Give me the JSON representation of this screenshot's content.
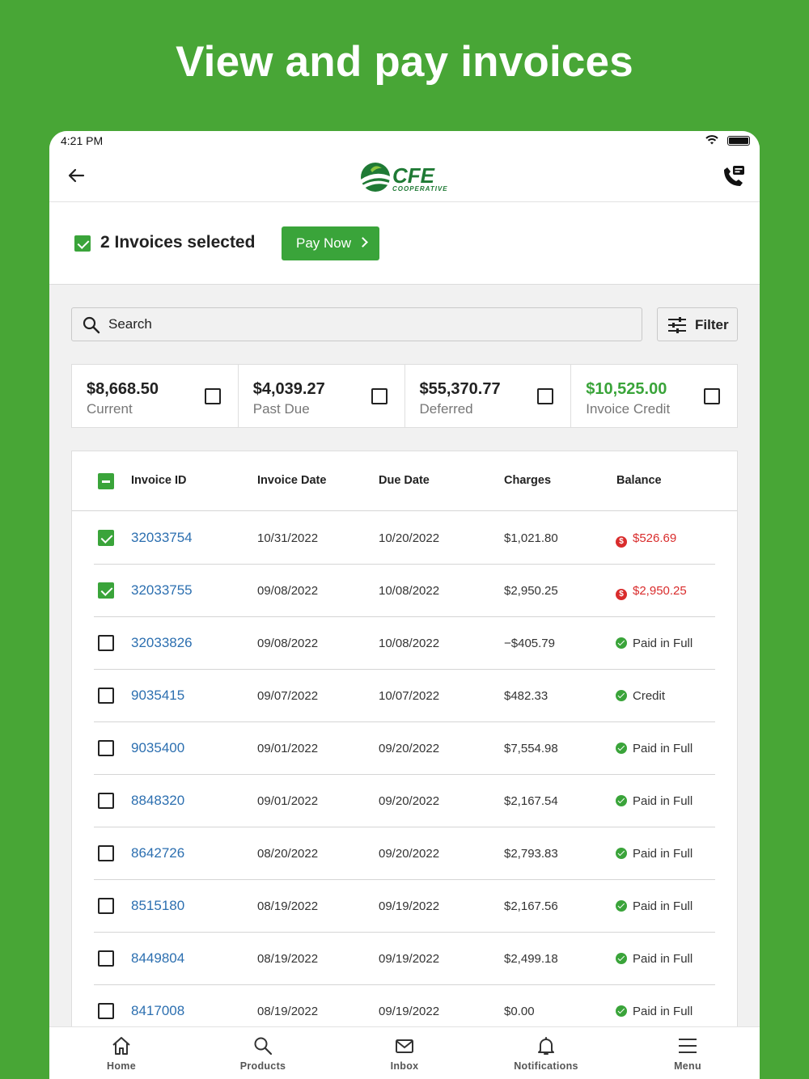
{
  "headline": "View and pay invoices",
  "status_bar": {
    "time": "4:21 PM"
  },
  "app_bar": {
    "logo_text": "CFE",
    "logo_subtext": "COOPERATIVE"
  },
  "selection": {
    "text": "2 Invoices selected",
    "pay_label": "Pay Now"
  },
  "search": {
    "placeholder": "Search"
  },
  "filter_label": "Filter",
  "summary": [
    {
      "amount": "$8,668.50",
      "label": "Current",
      "accent": false,
      "checked": false
    },
    {
      "amount": "$4,039.27",
      "label": "Past Due",
      "accent": false,
      "checked": false
    },
    {
      "amount": "$55,370.77",
      "label": "Deferred",
      "accent": false,
      "checked": false
    },
    {
      "amount": "$10,525.00",
      "label": "Invoice Credit",
      "accent": true,
      "checked": false
    }
  ],
  "table": {
    "headers": {
      "invoice_id": "Invoice ID",
      "invoice_date": "Invoice Date",
      "due_date": "Due Date",
      "charges": "Charges",
      "balance": "Balance"
    },
    "rows": [
      {
        "id": "32033754",
        "invoice_date": "10/31/2022",
        "due_date": "10/20/2022",
        "charges": "$1,021.80",
        "balance": "$526.69",
        "status": "due",
        "checked": true
      },
      {
        "id": "32033755",
        "invoice_date": "09/08/2022",
        "due_date": "10/08/2022",
        "charges": "$2,950.25",
        "balance": "$2,950.25",
        "status": "due",
        "checked": true
      },
      {
        "id": "32033826",
        "invoice_date": "09/08/2022",
        "due_date": "10/08/2022",
        "charges": "−$405.79",
        "balance": "Paid in Full",
        "status": "paid",
        "checked": false
      },
      {
        "id": "9035415",
        "invoice_date": "09/07/2022",
        "due_date": "10/07/2022",
        "charges": "$482.33",
        "balance": "Credit",
        "status": "paid",
        "checked": false
      },
      {
        "id": "9035400",
        "invoice_date": "09/01/2022",
        "due_date": "09/20/2022",
        "charges": "$7,554.98",
        "balance": "Paid in Full",
        "status": "paid",
        "checked": false
      },
      {
        "id": "8848320",
        "invoice_date": "09/01/2022",
        "due_date": "09/20/2022",
        "charges": "$2,167.54",
        "balance": "Paid in Full",
        "status": "paid",
        "checked": false
      },
      {
        "id": "8642726",
        "invoice_date": "08/20/2022",
        "due_date": "09/20/2022",
        "charges": "$2,793.83",
        "balance": "Paid in Full",
        "status": "paid",
        "checked": false
      },
      {
        "id": "8515180",
        "invoice_date": "08/19/2022",
        "due_date": "09/19/2022",
        "charges": "$2,167.56",
        "balance": "Paid in Full",
        "status": "paid",
        "checked": false
      },
      {
        "id": "8449804",
        "invoice_date": "08/19/2022",
        "due_date": "09/19/2022",
        "charges": "$2,499.18",
        "balance": "Paid in Full",
        "status": "paid",
        "checked": false
      },
      {
        "id": "8417008",
        "invoice_date": "08/19/2022",
        "due_date": "09/19/2022",
        "charges": "$0.00",
        "balance": "Paid in Full",
        "status": "paid",
        "checked": false
      }
    ]
  },
  "tabs": [
    {
      "label": "Home",
      "icon": "home-icon"
    },
    {
      "label": "Products",
      "icon": "search-icon"
    },
    {
      "label": "Inbox",
      "icon": "mail-icon"
    },
    {
      "label": "Notifications",
      "icon": "bell-icon"
    },
    {
      "label": "Menu",
      "icon": "hamburger-icon"
    }
  ],
  "colors": {
    "brand_green": "#48a636",
    "button_green": "#3aa43a",
    "link_blue": "#2c6fb0",
    "due_red": "#d92c2c"
  }
}
